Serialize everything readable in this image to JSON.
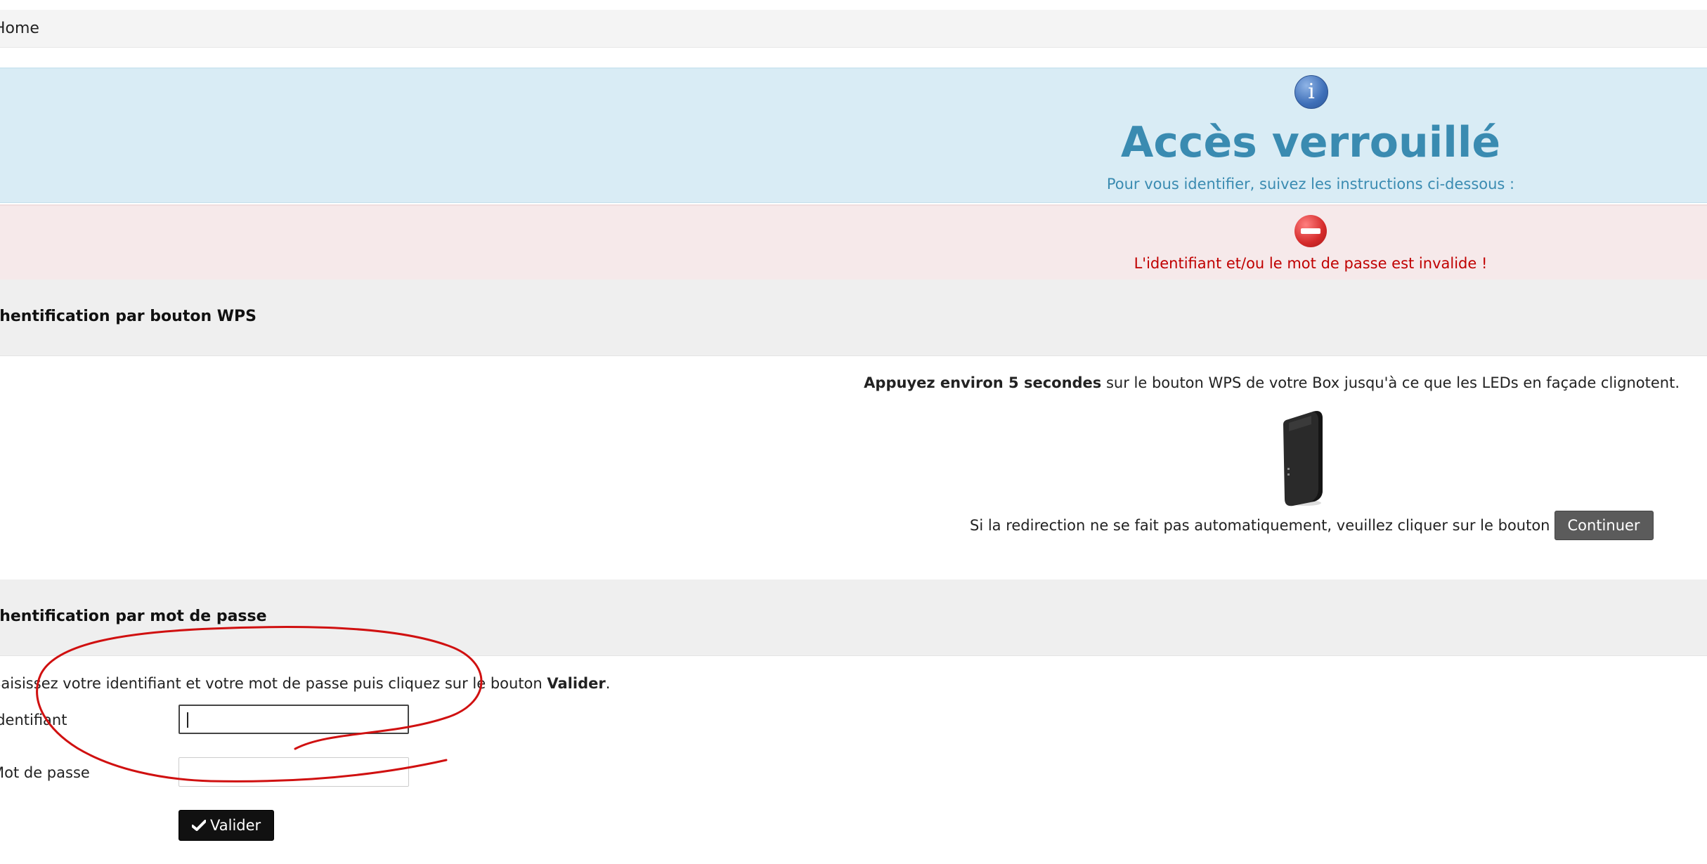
{
  "breadcrumb": {
    "home": "Home"
  },
  "info_banner": {
    "icon": "info-icon",
    "title": "Accès verrouillé",
    "subtitle": "Pour vous identifier, suivez les instructions ci-dessous :"
  },
  "error_banner": {
    "icon": "error-icon",
    "message": "L'identifiant et/ou le mot de passe est invalide !"
  },
  "wps_section": {
    "header": "Authentification par bouton WPS",
    "instruction_bold": "Appuyez environ 5 secondes",
    "instruction_rest": " sur le bouton WPS de votre Box jusqu'à ce que les LEDs en façade clignotent.",
    "redirect_text": "Si la redirection ne se fait pas automatiquement, veuillez cliquer sur le bouton",
    "continue_label": "Continuer"
  },
  "password_section": {
    "header": "Authentification par mot de passe",
    "instruction_prefix": "Saisissez votre identifiant et votre mot de passe puis cliquez sur le bouton ",
    "instruction_bold": "Valider",
    "instruction_suffix": ".",
    "username_label": "Identifiant",
    "username_value": "",
    "password_label": "Mot de passe",
    "password_value": "",
    "submit_label": "Valider",
    "submit_icon": "check-icon"
  },
  "colors": {
    "info_bg": "#d9ecf5",
    "info_text": "#3a8bb1",
    "error_bg": "#f6e9ea",
    "error_text": "#c00000",
    "annotation_red": "#d01010"
  }
}
